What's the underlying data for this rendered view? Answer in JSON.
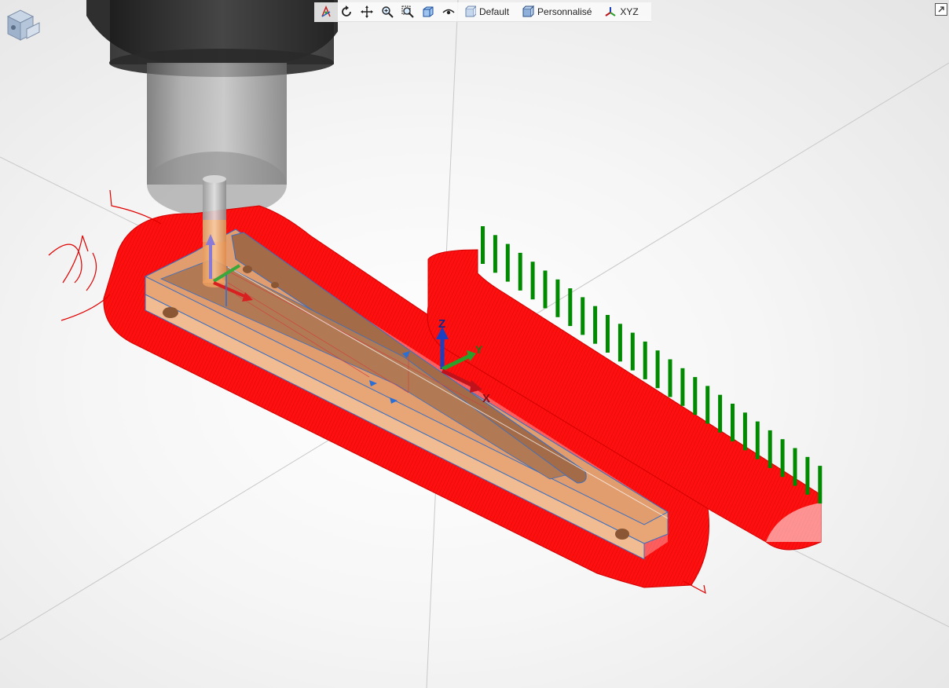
{
  "toolbar": {
    "buttons": [
      {
        "icon": "select-icon",
        "active": true
      },
      {
        "icon": "rotate-icon"
      },
      {
        "icon": "pan-icon"
      },
      {
        "icon": "zoom-icon"
      },
      {
        "icon": "zoom-window-icon"
      },
      {
        "icon": "view-box-icon"
      },
      {
        "icon": "visibility-eye-icon"
      }
    ],
    "default_label": "Default",
    "custom_label": "Personnalisé",
    "xyz_label": "XYZ"
  },
  "axes": {
    "z_label": "Z",
    "y_label": "Y",
    "x_label": "X",
    "colors": {
      "x": "#c0121a",
      "y": "#2aa02a",
      "z": "#1a3fc0"
    }
  },
  "colors": {
    "toolpath": "#ff0000",
    "part": "#e5a47c",
    "part_dark": "#a06a48",
    "lead_lines": "#008a00",
    "holder": "#6a6a6a"
  },
  "view_cube": {
    "icon": "view-cube-icon"
  },
  "maximize": {
    "icon": "maximize-icon"
  }
}
